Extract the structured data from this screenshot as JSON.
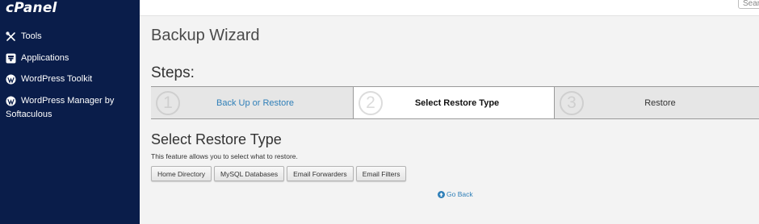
{
  "sidebar": {
    "logo": "cPanel",
    "items": [
      {
        "label": "Tools",
        "icon": "tools-icon"
      },
      {
        "label": "Applications",
        "icon": "applications-icon"
      },
      {
        "label": "WordPress Toolkit",
        "icon": "wordpress-icon"
      },
      {
        "label_line1": "WordPress Manager by",
        "label_line2": "Softaculous",
        "icon": "wordpress-icon"
      }
    ]
  },
  "topbar": {
    "search_text": "Sear"
  },
  "main": {
    "title": "Backup Wizard",
    "steps_title": "Steps:",
    "steps": [
      {
        "num": "1",
        "label": "Back Up or Restore",
        "state": "link"
      },
      {
        "num": "2",
        "label": "Select Restore Type",
        "state": "current"
      },
      {
        "num": "3",
        "label": "Restore",
        "state": "pending"
      }
    ],
    "section_title": "Select Restore Type",
    "section_desc": "This feature allows you to select what to restore.",
    "buttons": [
      "Home Directory",
      "MySQL Databases",
      "Email Forwarders",
      "Email Filters"
    ],
    "go_back": "Go Back"
  },
  "colors": {
    "sidebar_bg": "#0a1d4a",
    "link": "#2f7fb8"
  }
}
